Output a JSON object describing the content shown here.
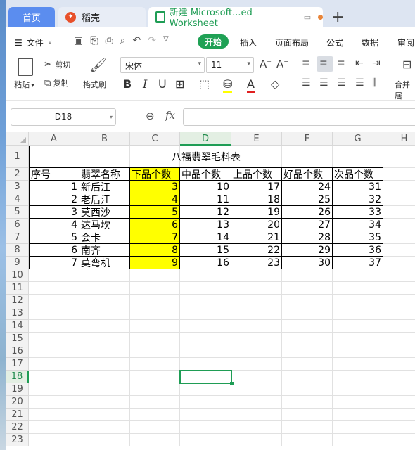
{
  "tabs": {
    "home": "首页",
    "daoke": "稻壳",
    "document": "新建 Microsoft...ed Worksheet"
  },
  "menu": {
    "file": "文件",
    "start": "开始",
    "insert": "插入",
    "page_layout": "页面布局",
    "formula": "公式",
    "data": "数据",
    "review": "审阅"
  },
  "ribbon": {
    "paste": "粘贴",
    "cut": "剪切",
    "copy": "复制",
    "format_painter": "格式刷",
    "font_name": "宋体",
    "font_size": "11",
    "merge": "合并居"
  },
  "formula_bar": {
    "name_box": "D18",
    "fx": "fx",
    "formula": ""
  },
  "columns": [
    "A",
    "B",
    "C",
    "D",
    "E",
    "F",
    "G",
    "H"
  ],
  "rows": [
    "1",
    "2",
    "3",
    "4",
    "5",
    "6",
    "7",
    "8",
    "9",
    "10",
    "11",
    "12",
    "13",
    "14",
    "15",
    "16",
    "17",
    "18",
    "19",
    "20",
    "21",
    "22",
    "23"
  ],
  "active_cell": {
    "column": "D",
    "row": "18"
  },
  "sheet": {
    "title": "八福翡翠毛料表",
    "headers": [
      "序号",
      "翡翠名称",
      "下品个数",
      "中品个数",
      "上品个数",
      "好品个数",
      "次品个数"
    ],
    "rows": [
      [
        "1",
        "新后江",
        "3",
        "10",
        "17",
        "24",
        "31"
      ],
      [
        "2",
        "老后江",
        "4",
        "11",
        "18",
        "25",
        "32"
      ],
      [
        "3",
        "莫西沙",
        "5",
        "12",
        "19",
        "26",
        "33"
      ],
      [
        "4",
        "达马坎",
        "6",
        "13",
        "20",
        "27",
        "34"
      ],
      [
        "5",
        "会卡",
        "7",
        "14",
        "21",
        "28",
        "35"
      ],
      [
        "6",
        "南齐",
        "8",
        "15",
        "22",
        "29",
        "36"
      ],
      [
        "7",
        "莫弯机",
        "9",
        "16",
        "23",
        "30",
        "37"
      ]
    ],
    "highlight_column": "C",
    "highlight_color": "#ffff00"
  },
  "colors": {
    "accent": "#1f9d55",
    "home_tab": "#5b8def"
  }
}
